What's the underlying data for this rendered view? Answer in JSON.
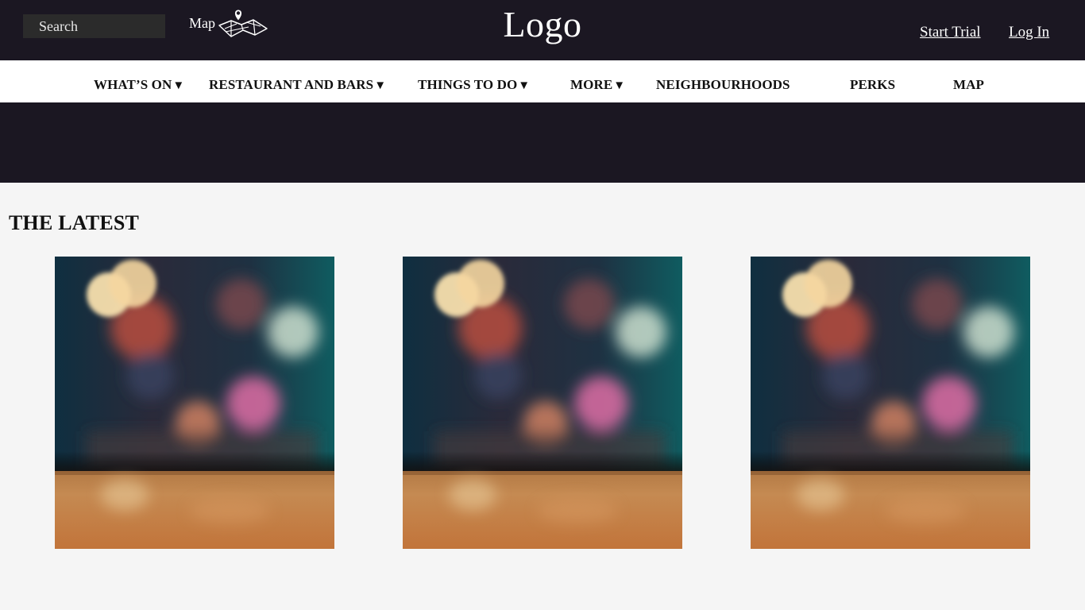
{
  "header": {
    "search_placeholder": "Search",
    "map_label": "Map",
    "logo": "Logo",
    "start_trial": "Start Trial",
    "log_in": "Log In"
  },
  "nav": {
    "items": [
      {
        "label": "WHAT’S ON",
        "caret": "▼"
      },
      {
        "label": "RESTAURANT AND BARS",
        "caret": "▼"
      },
      {
        "label": "THINGS TO DO",
        "caret": "▼"
      },
      {
        "label": "MORE",
        "caret": "▼"
      },
      {
        "label": "NEIGHBOURHOODS"
      },
      {
        "label": "PERKS"
      },
      {
        "label": "MAP"
      }
    ]
  },
  "latest": {
    "title": "THE LATEST",
    "cards": [
      {
        "image": "blurred-bar-bokeh-photo"
      },
      {
        "image": "blurred-bar-bokeh-photo"
      },
      {
        "image": "blurred-bar-bokeh-photo"
      }
    ]
  },
  "colors": {
    "header_bg": "#1b1722",
    "nav_bg": "#ffffff",
    "page_bg": "#f5f5f5",
    "search_bg": "#2b2b2b"
  }
}
